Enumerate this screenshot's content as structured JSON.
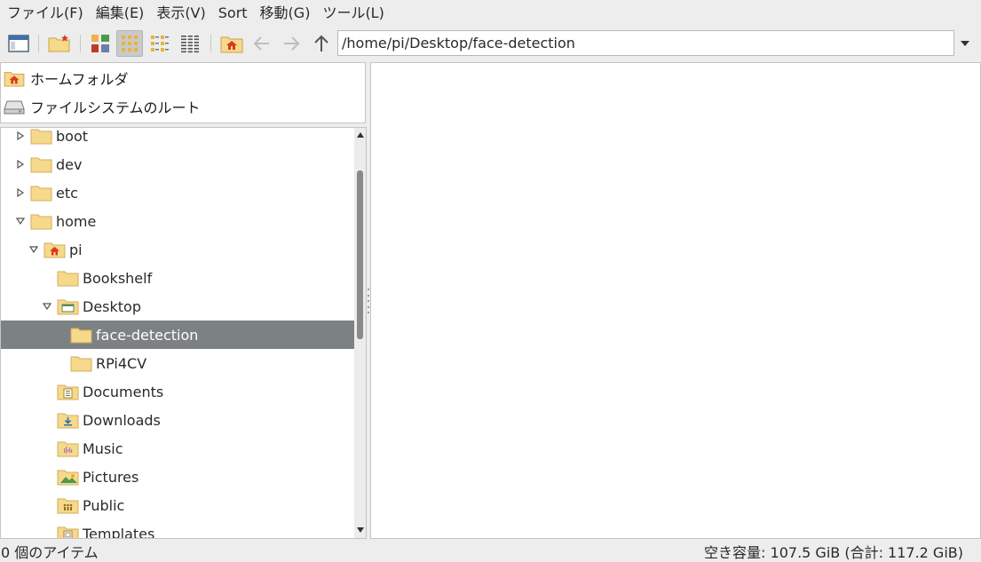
{
  "menubar": {
    "items": [
      {
        "label": "ファイル(F)"
      },
      {
        "label": "編集(E)"
      },
      {
        "label": "表示(V)"
      },
      {
        "label": "Sort"
      },
      {
        "label": "移動(G)"
      },
      {
        "label": "ツール(L)"
      }
    ]
  },
  "toolbar": {
    "path": "/home/pi/Desktop/face-detection",
    "active_view": "icon-view"
  },
  "places": {
    "items": [
      {
        "label": "ホームフォルダ",
        "icon": "home-folder-icon"
      },
      {
        "label": "ファイルシステムのルート",
        "icon": "drive-icon"
      }
    ]
  },
  "tree": {
    "items": [
      {
        "label": "boot",
        "depth": 0,
        "expander": "collapsed",
        "icon": "folder-icon"
      },
      {
        "label": "dev",
        "depth": 0,
        "expander": "collapsed",
        "icon": "folder-icon"
      },
      {
        "label": "etc",
        "depth": 0,
        "expander": "collapsed",
        "icon": "folder-icon"
      },
      {
        "label": "home",
        "depth": 0,
        "expander": "expanded",
        "icon": "folder-icon"
      },
      {
        "label": "pi",
        "depth": 1,
        "expander": "expanded",
        "icon": "home-folder-icon"
      },
      {
        "label": "Bookshelf",
        "depth": 2,
        "expander": "none",
        "icon": "folder-icon"
      },
      {
        "label": "Desktop",
        "depth": 2,
        "expander": "expanded",
        "icon": "desktop-folder-icon"
      },
      {
        "label": "face-detection",
        "depth": 3,
        "expander": "none",
        "icon": "folder-icon",
        "selected": true
      },
      {
        "label": "RPi4CV",
        "depth": 3,
        "expander": "none",
        "icon": "folder-icon"
      },
      {
        "label": "Documents",
        "depth": 2,
        "expander": "none",
        "icon": "documents-folder-icon"
      },
      {
        "label": "Downloads",
        "depth": 2,
        "expander": "none",
        "icon": "downloads-folder-icon"
      },
      {
        "label": "Music",
        "depth": 2,
        "expander": "none",
        "icon": "music-folder-icon"
      },
      {
        "label": "Pictures",
        "depth": 2,
        "expander": "none",
        "icon": "pictures-folder-icon"
      },
      {
        "label": "Public",
        "depth": 2,
        "expander": "none",
        "icon": "public-folder-icon"
      },
      {
        "label": "Templates",
        "depth": 2,
        "expander": "none",
        "icon": "templates-folder-icon"
      }
    ]
  },
  "status": {
    "items": "0 個のアイテム",
    "free_space": "空き容量: 107.5 GiB (合計: 117.2 GiB)"
  },
  "colors": {
    "folder": "#f7d98b",
    "selection": "#7c8184",
    "home_accent": "#d63c1e"
  }
}
